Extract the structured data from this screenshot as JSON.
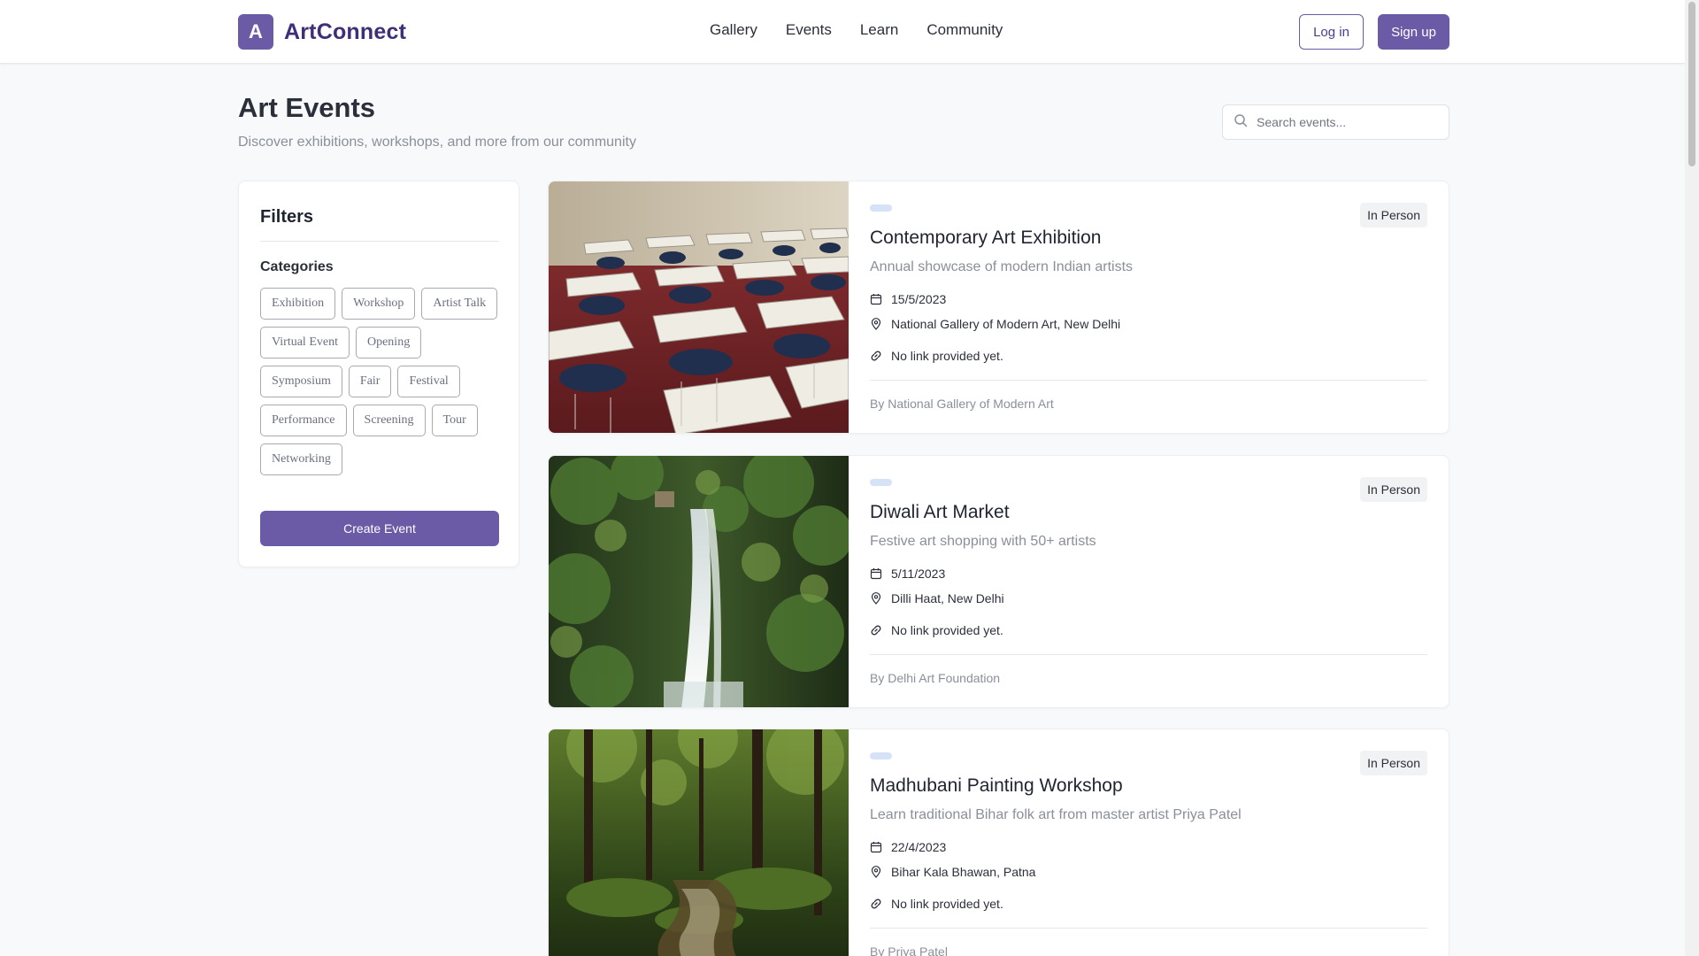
{
  "header": {
    "logo_letter": "A",
    "brand_name": "ArtConnect",
    "nav": [
      "Gallery",
      "Events",
      "Learn",
      "Community"
    ],
    "login_label": "Log in",
    "signup_label": "Sign up"
  },
  "page": {
    "title": "Art Events",
    "subtitle": "Discover exhibitions, workshops, and more from our community"
  },
  "search": {
    "placeholder": "Search events...",
    "value": ""
  },
  "filters": {
    "title": "Filters",
    "categories_label": "Categories",
    "categories": [
      "Exhibition",
      "Workshop",
      "Artist Talk",
      "Virtual Event",
      "Opening",
      "Symposium",
      "Fair",
      "Festival",
      "Performance",
      "Screening",
      "Tour",
      "Networking"
    ],
    "create_label": "Create Event"
  },
  "events": [
    {
      "title": "Contemporary Art Exhibition",
      "description": "Annual showcase of modern Indian artists",
      "date": "15/5/2023",
      "location": "National Gallery of Modern Art, New Delhi",
      "link": "No link provided yet.",
      "organizer": "By National Gallery of Modern Art",
      "mode": "In Person",
      "image": "classroom-desks"
    },
    {
      "title": "Diwali Art Market",
      "description": "Festive art shopping with 50+ artists",
      "date": "5/11/2023",
      "location": "Dilli Haat, New Delhi",
      "link": "No link provided yet.",
      "organizer": "By Delhi Art Foundation",
      "mode": "In Person",
      "image": "waterfall"
    },
    {
      "title": "Madhubani Painting Workshop",
      "description": "Learn traditional Bihar folk art from master artist Priya Patel",
      "date": "22/4/2023",
      "location": "Bihar Kala Bhawan, Patna",
      "link": "No link provided yet.",
      "organizer": "By Priya Patel",
      "mode": "In Person",
      "image": "forest-stream"
    }
  ],
  "colors": {
    "brand": "#6b5aa6",
    "brand_dark": "#3f2f78",
    "pill": "#d6e2f5"
  }
}
